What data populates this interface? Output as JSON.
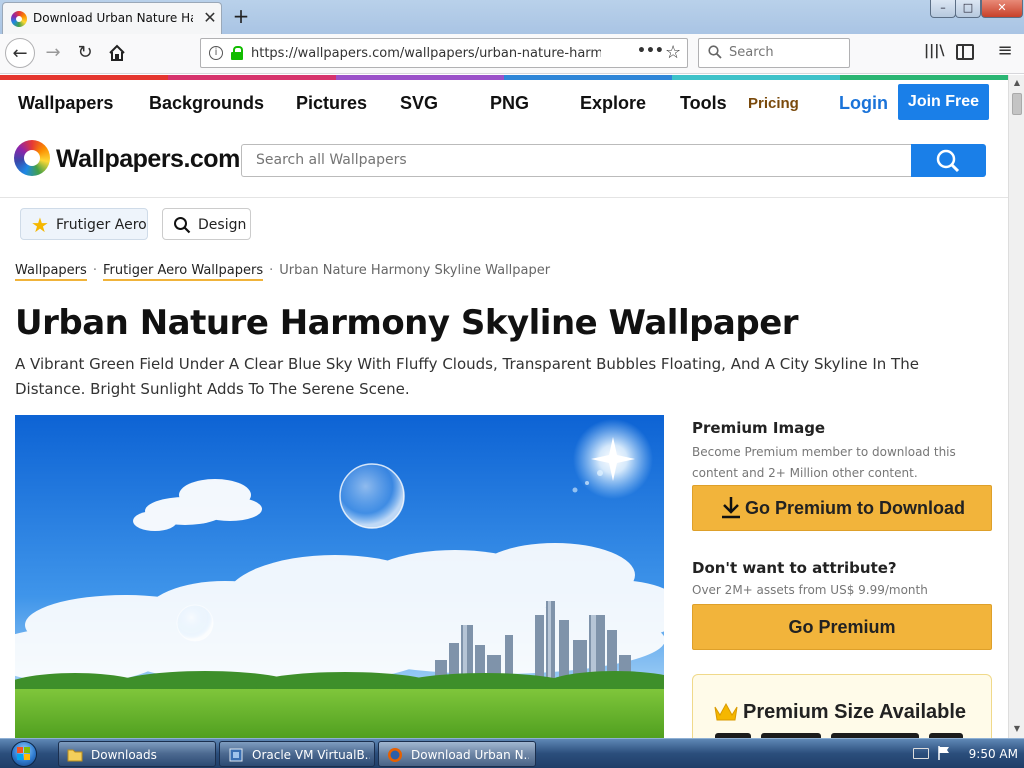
{
  "browser": {
    "tab_title": "Download Urban Nature Harmony",
    "tab_close": "✕",
    "new_tab": "+",
    "url": "https://wallpapers.com/wallpapers/urban-nature-harmony-s",
    "search_placeholder": "Search",
    "icons": [
      "back-arrow-icon",
      "forward-arrow-icon",
      "reload-icon",
      "home-icon",
      "info-icon",
      "lock-icon",
      "page-actions-icon",
      "bookmark-star-icon",
      "search-icon",
      "library-icon",
      "sidebar-icon",
      "menu-icon"
    ]
  },
  "site": {
    "accent_color": "#1a7fe8",
    "gold_color": "#f2b43b",
    "rainbow_colors": [
      "#e5362f",
      "#d6336c",
      "#9b51c9",
      "#2f86d8",
      "#3ec2c9",
      "#2bb673"
    ],
    "nav": {
      "wallpapers": "Wallpapers",
      "backgrounds": "Backgrounds",
      "pictures": "Pictures",
      "svg": "SVG",
      "png": "PNG",
      "explore": "Explore",
      "tools": "Tools",
      "pricing": "Pricing",
      "login": "Login",
      "join": "Join Free"
    },
    "logo_text": "Wallpapers.com",
    "search_placeholder": "Search all Wallpapers"
  },
  "tags": [
    {
      "label": "Frutiger Aero",
      "icon": "star-icon"
    },
    {
      "label": "Design",
      "icon": "search-icon"
    }
  ],
  "breadcrumb": {
    "root": "Wallpapers",
    "section": "Frutiger Aero Wallpapers",
    "current": "Urban Nature Harmony Skyline Wallpaper",
    "separator": "·"
  },
  "page": {
    "title": "Urban Nature Harmony Skyline Wallpaper",
    "description": "A Vibrant Green Field Under A Clear Blue Sky With Fluffy Clouds, Transparent Bubbles Floating, And A City Skyline In The Distance. Bright Sunlight Adds To The Serene Scene."
  },
  "premium": {
    "title": "Premium Image",
    "text": "Become Premium member to download this content and 2+ Million other content.",
    "download_label": "Go Premium to Download",
    "attr_title": "Don't want to attribute?",
    "attr_text": "Over 2M+ assets from US$ 9.99/month",
    "go_premium_label": "Go Premium",
    "size_title": "Premium Size Available"
  },
  "taskbar": {
    "items": [
      {
        "label": "Downloads",
        "icon": "folder-icon"
      },
      {
        "label": "Oracle VM VirtualB...",
        "icon": "virtualbox-icon"
      },
      {
        "label": "Download Urban N...",
        "icon": "firefox-icon"
      }
    ],
    "clock": "9:50 AM"
  }
}
